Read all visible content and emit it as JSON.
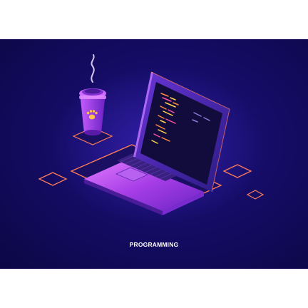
{
  "caption": "PROGRAMMING",
  "colors": {
    "background_top": "#1e1480",
    "background_bottom": "#0c0745",
    "laptop_body": "#b24be8",
    "laptop_keys": "#3a2180",
    "screen_bezel": "#2b1a6e",
    "screen_glass": "#120c3c",
    "outline_glow": "#ff7d5a",
    "code_orange": "#ff8a3d",
    "code_yellow": "#ffd34d",
    "code_pink": "#ff4fa3",
    "cup_body": "#9b3be0",
    "cup_lid": "#cf6bff",
    "steam": "#e8d9ff",
    "paw_icon": "#ffc34a"
  },
  "icons": [
    "laptop-icon",
    "coffee-cup-icon",
    "paw-icon",
    "steam-icon",
    "code-lines-icon"
  ]
}
